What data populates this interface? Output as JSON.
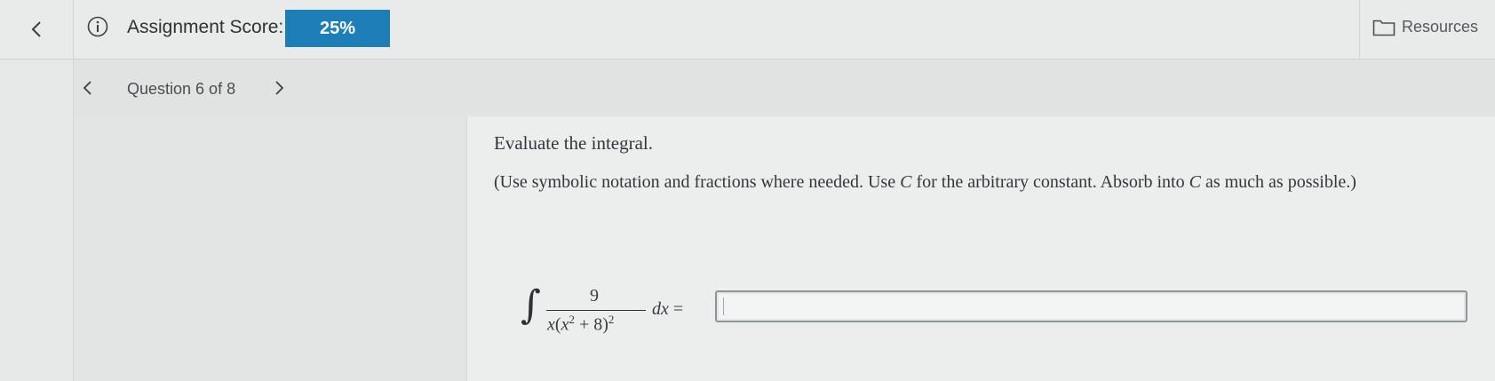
{
  "topbar": {
    "back_icon": "chevron-left-icon",
    "info_icon": "info-circle-icon",
    "score_label": "Assignment Score:",
    "score_value": "25%",
    "score_color": "#1e7fb8",
    "resources_icon": "folder-outline-icon",
    "resources_label": "Resources"
  },
  "question_nav": {
    "prev_icon": "chevron-left-icon",
    "label": "Question 6 of 8",
    "next_icon": "chevron-right-icon"
  },
  "question": {
    "prompt": "Evaluate the integral.",
    "instructions_part1": "(Use symbolic notation and fractions where needed. Use ",
    "constant_symbol": "C",
    "instructions_part2": " for the arbitrary constant. Absorb into ",
    "instructions_part3": " as much as possible.)",
    "integral": {
      "numerator": "9",
      "denominator_x": "x",
      "denominator_inner": "x",
      "inner_exponent": "2",
      "inner_constant": "+ 8",
      "outer_exponent": "2",
      "differential": "dx",
      "equals": "="
    },
    "answer_value": ""
  }
}
